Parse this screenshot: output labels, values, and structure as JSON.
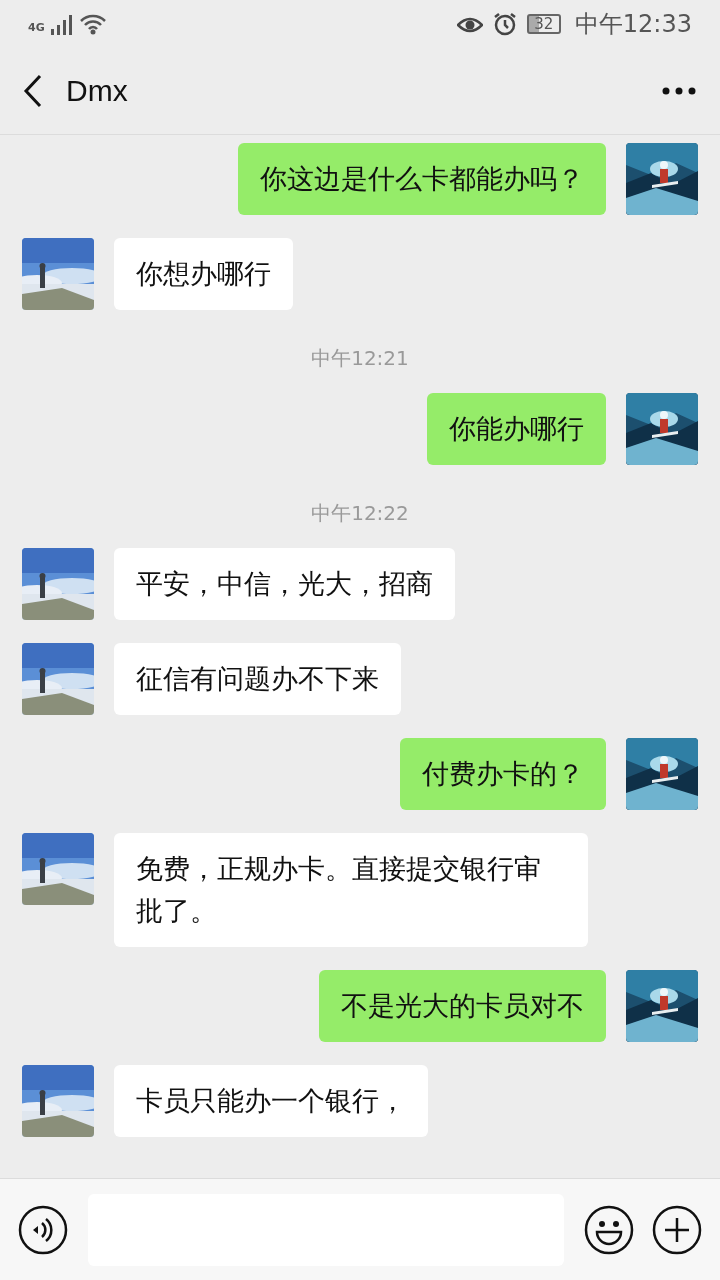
{
  "status_bar": {
    "network": "4G",
    "battery": "32",
    "time": "中午12:33"
  },
  "header": {
    "title": "Dmx"
  },
  "messages": [
    {
      "kind": "sent",
      "text": "你这边是什么卡都能办吗？"
    },
    {
      "kind": "received",
      "text": "你想办哪行"
    },
    {
      "kind": "time",
      "text": "中午12:21"
    },
    {
      "kind": "sent",
      "text": "你能办哪行"
    },
    {
      "kind": "time",
      "text": "中午12:22"
    },
    {
      "kind": "received",
      "text": "平安，中信，光大，招商"
    },
    {
      "kind": "received",
      "text": "征信有问题办不下来"
    },
    {
      "kind": "sent",
      "text": "付费办卡的？"
    },
    {
      "kind": "received",
      "text": "免费，正规办卡。直接提交银行审批了。"
    },
    {
      "kind": "sent",
      "text": "不是光大的卡员对不"
    },
    {
      "kind": "received",
      "text": "卡员只能办一个银行，"
    }
  ]
}
